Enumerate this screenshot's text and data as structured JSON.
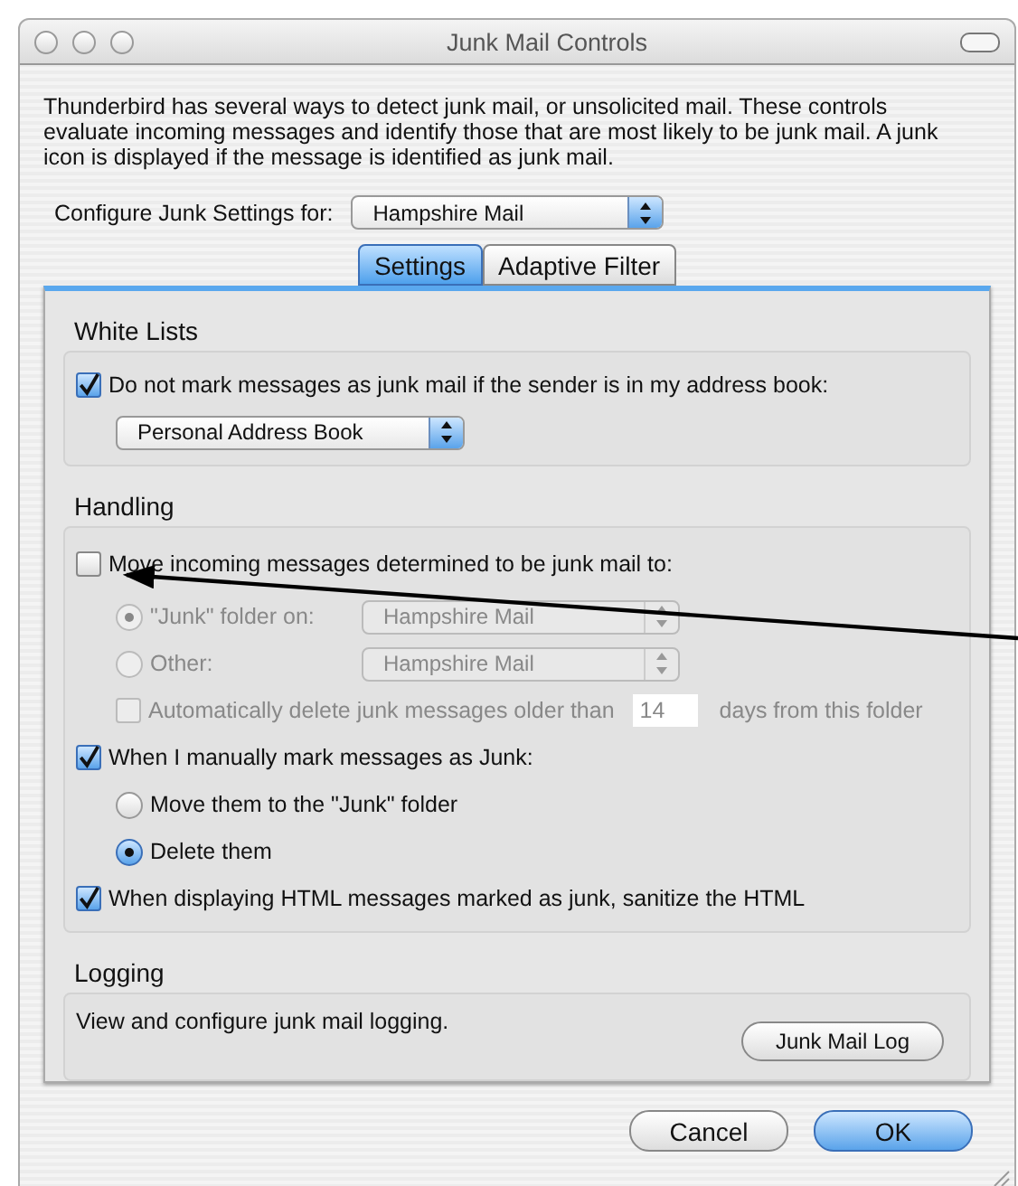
{
  "window": {
    "title": "Junk Mail Controls"
  },
  "intro": "Thunderbird has several ways to detect junk mail, or unsolicited mail. These controls evaluate incoming messages and identify those that are most likely to be junk mail. A junk icon is displayed if the message is identified as junk mail.",
  "configure": {
    "label": "Configure Junk Settings for:",
    "value": "Hampshire Mail"
  },
  "tabs": [
    {
      "label": "Settings",
      "selected": true
    },
    {
      "label": "Adaptive Filter",
      "selected": false
    }
  ],
  "white_lists": {
    "heading": "White Lists",
    "checkbox": {
      "label": "Do not mark messages as junk mail if the sender is in my address book:",
      "checked": true
    },
    "address_book": {
      "value": "Personal Address Book"
    }
  },
  "handling": {
    "heading": "Handling",
    "move_checkbox": {
      "label": "Move incoming messages determined to be junk mail to:",
      "checked": false
    },
    "destinations": [
      {
        "label": "\"Junk\" folder on:",
        "selected": true,
        "disabled": true,
        "value": "Hampshire Mail"
      },
      {
        "label": "Other:",
        "selected": false,
        "disabled": true,
        "value": "Hampshire Mail"
      }
    ],
    "auto_delete": {
      "label": "Automatically delete junk messages older than",
      "checked": false,
      "disabled": true,
      "days": "14",
      "suffix": "days from this folder"
    },
    "manual_checkbox": {
      "label": "When I manually mark messages as Junk:",
      "checked": true
    },
    "manual_actions": [
      {
        "label": "Move them to the \"Junk\" folder",
        "selected": false
      },
      {
        "label": "Delete them",
        "selected": true
      }
    ],
    "sanitize_checkbox": {
      "label": "When displaying HTML messages marked as junk, sanitize the HTML",
      "checked": true
    }
  },
  "logging": {
    "heading": "Logging",
    "description": "View and configure junk mail logging.",
    "button": "Junk Mail Log"
  },
  "buttons": [
    {
      "label": "Cancel",
      "default": false
    },
    {
      "label": "OK",
      "default": true
    }
  ]
}
